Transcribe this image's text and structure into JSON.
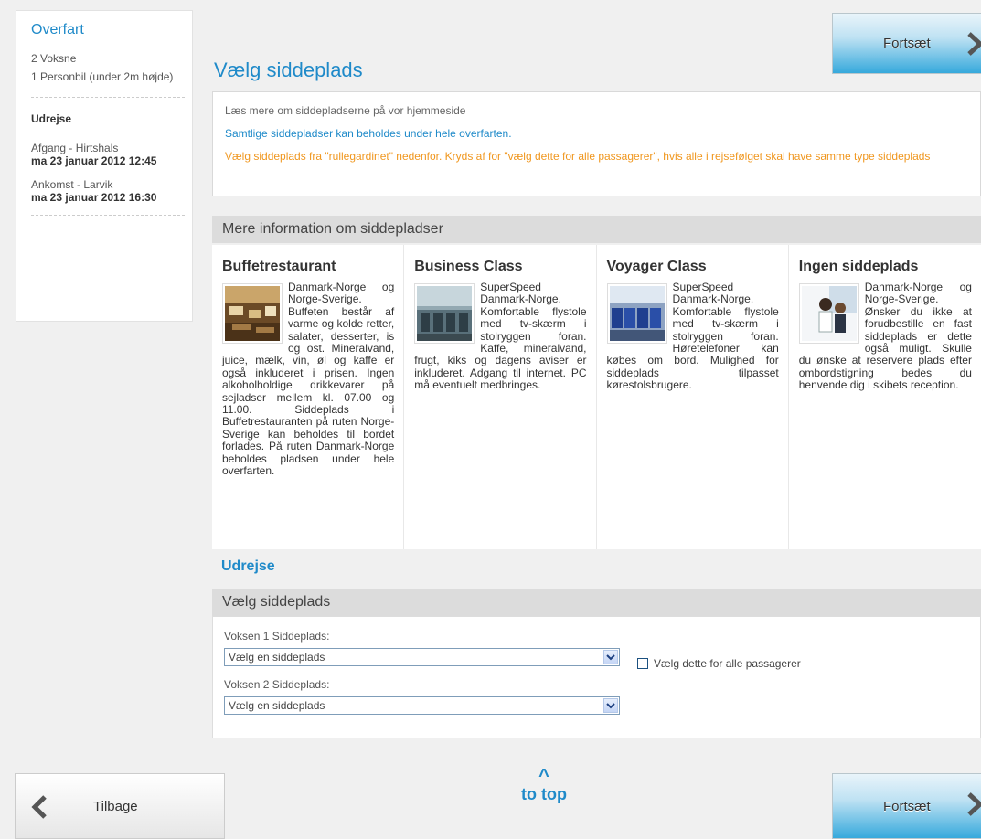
{
  "sidebar": {
    "title": "Overfart",
    "passengers": "2 Voksne",
    "vehicle": "1 Personbil (under 2m højde)",
    "direction": "Udrejse",
    "departure_label": "Afgang - Hirtshals",
    "departure_time": "ma 23 januar 2012 12:45",
    "arrival_label": "Ankomst - Larvik",
    "arrival_time": "ma 23 januar 2012 16:30"
  },
  "header": {
    "page_title": "Vælg siddeplads",
    "continue_label": "Fortsæt"
  },
  "info": {
    "line1": "Læs mere om siddepladserne på vor hjemmeside",
    "line2": "Samtlige siddepladser kan beholdes under hele overfarten.",
    "line3": "Vælg siddeplads fra \"rullegardinet\" nedenfor. Kryds af for \"vælg dette for alle passagerer\", hvis alle i rejsefølget skal have samme type siddeplads"
  },
  "more_info": {
    "heading": "Mere information om siddepladser",
    "cards": [
      {
        "title": "Buffetrestaurant",
        "text": "Danmark-Norge og Norge-Sverige. Buffeten består af varme og kolde retter, salater, desserter, is og ost. Mineralvand, juice, mælk, vin, øl og kaffe er også inkluderet i prisen. Ingen alkoholholdige drikkevarer på sejladser mellem kl. 07.00 og 11.00. Siddeplads i Buffetrestauranten på ruten Norge-Sverige kan beholdes til bordet forlades. På ruten Danmark-Norge beholdes pladsen under hele overfarten.",
        "image": "restaurant-photo"
      },
      {
        "title": "Business Class",
        "text": "SuperSpeed Danmark-Norge. Komfortable flystole med tv-skærm i stolryggen foran. Kaffe, mineralvand, frugt, kiks og dagens aviser er inkluderet. Adgang til internet. PC må eventuelt medbringes.",
        "image": "business-class-photo"
      },
      {
        "title": "Voyager Class",
        "text": "SuperSpeed Danmark-Norge. Komfortable flystole med tv-skærm i stolryggen foran. Høretelefoner kan købes om bord. Mulighed for siddeplads tilpasset kørestolsbrugere.",
        "image": "voyager-class-photo"
      },
      {
        "title": "Ingen siddeplads",
        "text": "Danmark-Norge og Norge-Sverige. Ønsker du ikke at forudbestille en fast siddeplads er dette også muligt. Skulle du ønske at reservere plads efter ombordstigning bedes du henvende dig i skibets reception.",
        "image": "people-photo"
      }
    ]
  },
  "seat_selection": {
    "direction": "Udrejse",
    "heading": "Vælg siddeplads",
    "passenger1_label": "Voksen 1 Siddeplads:",
    "passenger1_value": "Vælg en siddeplads",
    "passenger2_label": "Voksen 2 Siddeplads:",
    "passenger2_value": "Vælg en siddeplads",
    "apply_all_label": "Vælg dette for alle passagerer"
  },
  "footer": {
    "back_label": "Tilbage",
    "to_top_caret": "^",
    "to_top_label": "to top",
    "continue_label": "Fortsæt"
  }
}
